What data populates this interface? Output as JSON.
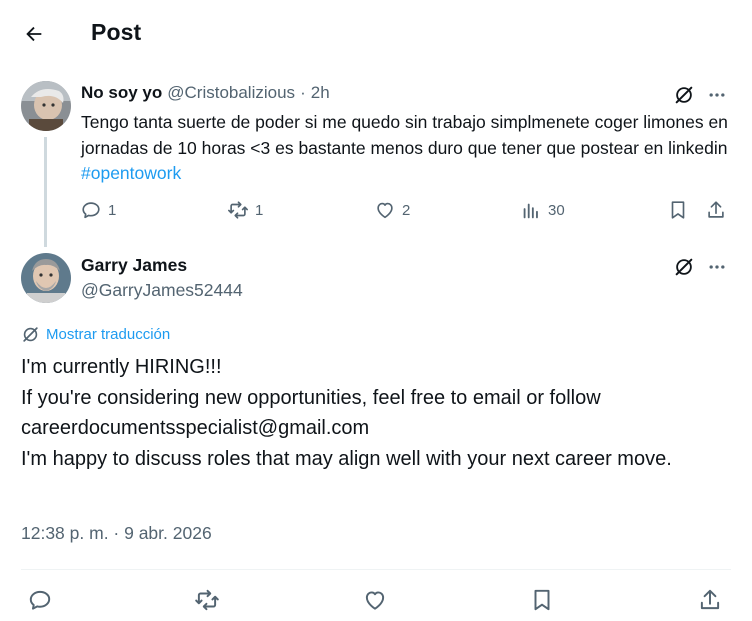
{
  "header": {
    "title": "Post",
    "back_icon": "arrow-left-icon"
  },
  "parent_tweet": {
    "display_name": "No soy yo",
    "handle": "@Cristobalizious",
    "separator": "·",
    "time": "2h",
    "text_main": "Tengo tanta suerte de poder si me quedo sin trabajo simplmenete coger limones en jornadas de 10 horas <3 es bastante menos duro que tener que postear en linkedin ",
    "hashtag": "#opentowork",
    "stats": {
      "replies": "1",
      "reposts": "1",
      "likes": "2",
      "views": "30"
    }
  },
  "main_tweet": {
    "display_name": "Garry James",
    "handle": "@GarryJames52444",
    "translate_label": "Mostrar traducción",
    "lines": [
      "I'm currently HIRING!!!",
      "If you're considering new opportunities, feel free to email or follow",
      "careerdocumentsspecialist@gmail.com",
      "I'm happy to discuss roles that may align well with your next career move."
    ],
    "timestamp": "12:38 p. m. · 9 abr. 2026"
  },
  "colors": {
    "accent": "#1d9bf0",
    "muted": "#536471",
    "text": "#0f1419",
    "line": "#cfd9de"
  }
}
